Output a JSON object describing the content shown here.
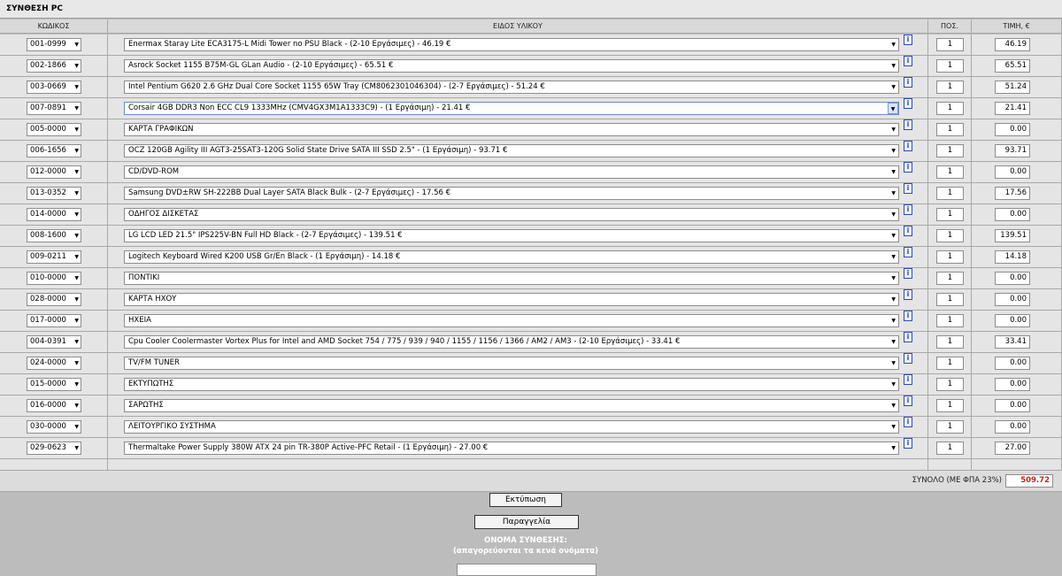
{
  "window": {
    "title": "ΣΥΝΘΕΣΗ PC"
  },
  "columns": {
    "code": "ΚΩΔΙΚΟΣ",
    "description": "ΕΙΔΟΣ ΥΛΙΚΟΥ",
    "qty": "ΠΟΣ.",
    "price": "ΤΙΜΗ, €"
  },
  "info_symbol": "i",
  "dropdown_symbol": "▼",
  "rows": [
    {
      "code": "001-0999",
      "desc": "Enermax Staray Lite ECA3175-L Midi Tower no PSU Black - (2-10 Εργάσιμες) - 46.19 €",
      "qty": "1",
      "price": "46.19"
    },
    {
      "code": "002-1866",
      "desc": "Asrock Socket 1155 B75M-GL GLan Audio - (2-10 Εργάσιμες) - 65.51 €",
      "qty": "1",
      "price": "65.51"
    },
    {
      "code": "003-0669",
      "desc": "Intel Pentium G620 2.6 GHz Dual Core Socket 1155 65W Tray (CM8062301046304) - (2-7 Εργάσιμες) - 51.24 €",
      "qty": "1",
      "price": "51.24"
    },
    {
      "code": "007-0891",
      "desc": "Corsair 4GB DDR3 Non ECC CL9 1333MHz (CMV4GX3M1A1333C9) - (1 Εργάσιμη) - 21.41 €",
      "qty": "1",
      "price": "21.41"
    },
    {
      "code": "005-0000",
      "desc": "ΚΑΡΤΑ ΓΡΑΦΙΚΩΝ",
      "qty": "1",
      "price": "0.00"
    },
    {
      "code": "006-1656",
      "desc": "OCZ 120GB Agility III AGT3-25SAT3-120G Solid State Drive SATA III SSD 2.5\" - (1 Εργάσιμη) - 93.71 €",
      "qty": "1",
      "price": "93.71"
    },
    {
      "code": "012-0000",
      "desc": "CD/DVD-ROM",
      "qty": "1",
      "price": "0.00"
    },
    {
      "code": "013-0352",
      "desc": "Samsung DVD±RW SH-222BB Dual Layer SATA Black Bulk - (2-7 Εργάσιμες) - 17.56 €",
      "qty": "1",
      "price": "17.56"
    },
    {
      "code": "014-0000",
      "desc": "ΟΔΗΓΟΣ ΔΙΣΚΕΤΑΣ",
      "qty": "1",
      "price": "0.00"
    },
    {
      "code": "008-1600",
      "desc": "LG LCD LED 21.5\" IPS225V-BN Full HD Black - (2-7 Εργάσιμες) - 139.51 €",
      "qty": "1",
      "price": "139.51"
    },
    {
      "code": "009-0211",
      "desc": "Logitech Keyboard Wired K200 USB Gr/En Black - (1 Εργάσιμη) - 14.18 €",
      "qty": "1",
      "price": "14.18"
    },
    {
      "code": "010-0000",
      "desc": "ΠΟΝΤΙΚΙ",
      "qty": "1",
      "price": "0.00"
    },
    {
      "code": "028-0000",
      "desc": "ΚΑΡΤΑ ΗΧΟΥ",
      "qty": "1",
      "price": "0.00"
    },
    {
      "code": "017-0000",
      "desc": "ΗΧΕΙΑ",
      "qty": "1",
      "price": "0.00"
    },
    {
      "code": "004-0391",
      "desc": "Cpu Cooler Coolermaster Vortex Plus for Intel and AMD Socket 754 / 775 / 939 / 940 / 1155 / 1156 / 1366 / AM2 / AM3 - (2-10 Εργάσιμες) - 33.41 €",
      "qty": "1",
      "price": "33.41"
    },
    {
      "code": "024-0000",
      "desc": "TV/FM TUNER",
      "qty": "1",
      "price": "0.00"
    },
    {
      "code": "015-0000",
      "desc": "ΕΚΤΥΠΩΤΗΣ",
      "qty": "1",
      "price": "0.00"
    },
    {
      "code": "016-0000",
      "desc": "ΣΑΡΩΤΗΣ",
      "qty": "1",
      "price": "0.00"
    },
    {
      "code": "030-0000",
      "desc": "ΛΕΙΤΟΥΡΓΙΚΟ ΣΥΣΤΗΜΑ",
      "qty": "1",
      "price": "0.00"
    },
    {
      "code": "029-0623",
      "desc": "Thermaltake Power Supply 380W ATX 24 pin TR-380P Active-PFC Retail - (1 Εργάσιμη) - 27.00 €",
      "qty": "1",
      "price": "27.00"
    }
  ],
  "total": {
    "label": "ΣΥΝΟΛΟ (ΜΕ ΦΠΑ 23%)",
    "value": "509.72"
  },
  "buttons": {
    "print": "Εκτύπωση",
    "order": "Παραγγελία"
  },
  "name_section": {
    "label": "ΟΝΟΜΑ ΣΥΝΘΕΣΗΣ:",
    "note": "(απαγορεύονται τα κενά ονόματα)",
    "value": ""
  },
  "colors": {
    "total_value": "#d02020",
    "info_icon": "#2b4ab8",
    "background": "#bcbcbc"
  }
}
